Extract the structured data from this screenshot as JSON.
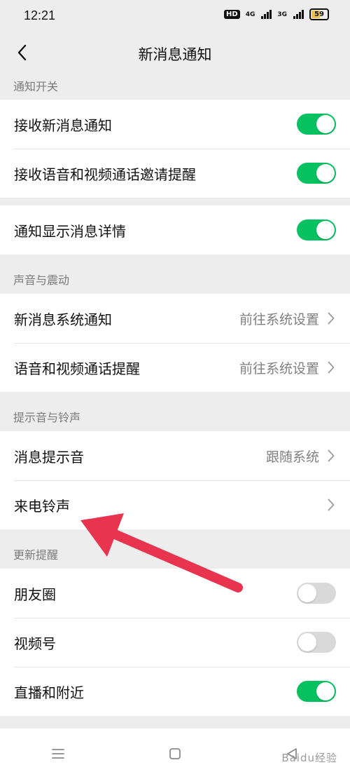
{
  "status_bar": {
    "time": "12:21",
    "hd_label": "HD",
    "net1": "4G",
    "net2": "3G",
    "battery": "59"
  },
  "header": {
    "title": "新消息通知",
    "back_icon": "chevron-left-icon"
  },
  "sections": {
    "notify_switch": {
      "header": "通知开关",
      "rows": [
        {
          "label": "接收新消息通知",
          "on": true
        },
        {
          "label": "接收语音和视频通话邀请提醒",
          "on": true
        }
      ],
      "detail_row": {
        "label": "通知显示消息详情",
        "on": true
      }
    },
    "sound": {
      "header": "声音与震动",
      "rows": [
        {
          "label": "新消息系统通知",
          "value": "前往系统设置"
        },
        {
          "label": "语音和视频通话提醒",
          "value": "前往系统设置"
        }
      ]
    },
    "ringtone": {
      "header": "提示音与铃声",
      "rows": [
        {
          "label": "消息提示音",
          "value": "跟随系统"
        },
        {
          "label": "来电铃声",
          "value": ""
        }
      ]
    },
    "updates": {
      "header": "更新提醒",
      "rows": [
        {
          "label": "朋友圈",
          "on": false
        },
        {
          "label": "视频号",
          "on": false
        },
        {
          "label": "直播和附近",
          "on": true
        }
      ]
    }
  },
  "colors": {
    "toggle_on": "#07c160",
    "toggle_off": "#d9d9d9",
    "annotation_arrow": "#e8344e"
  },
  "bottom_nav": [
    "menu-icon",
    "home-icon",
    "back-icon"
  ],
  "watermark": "Baidu经验"
}
